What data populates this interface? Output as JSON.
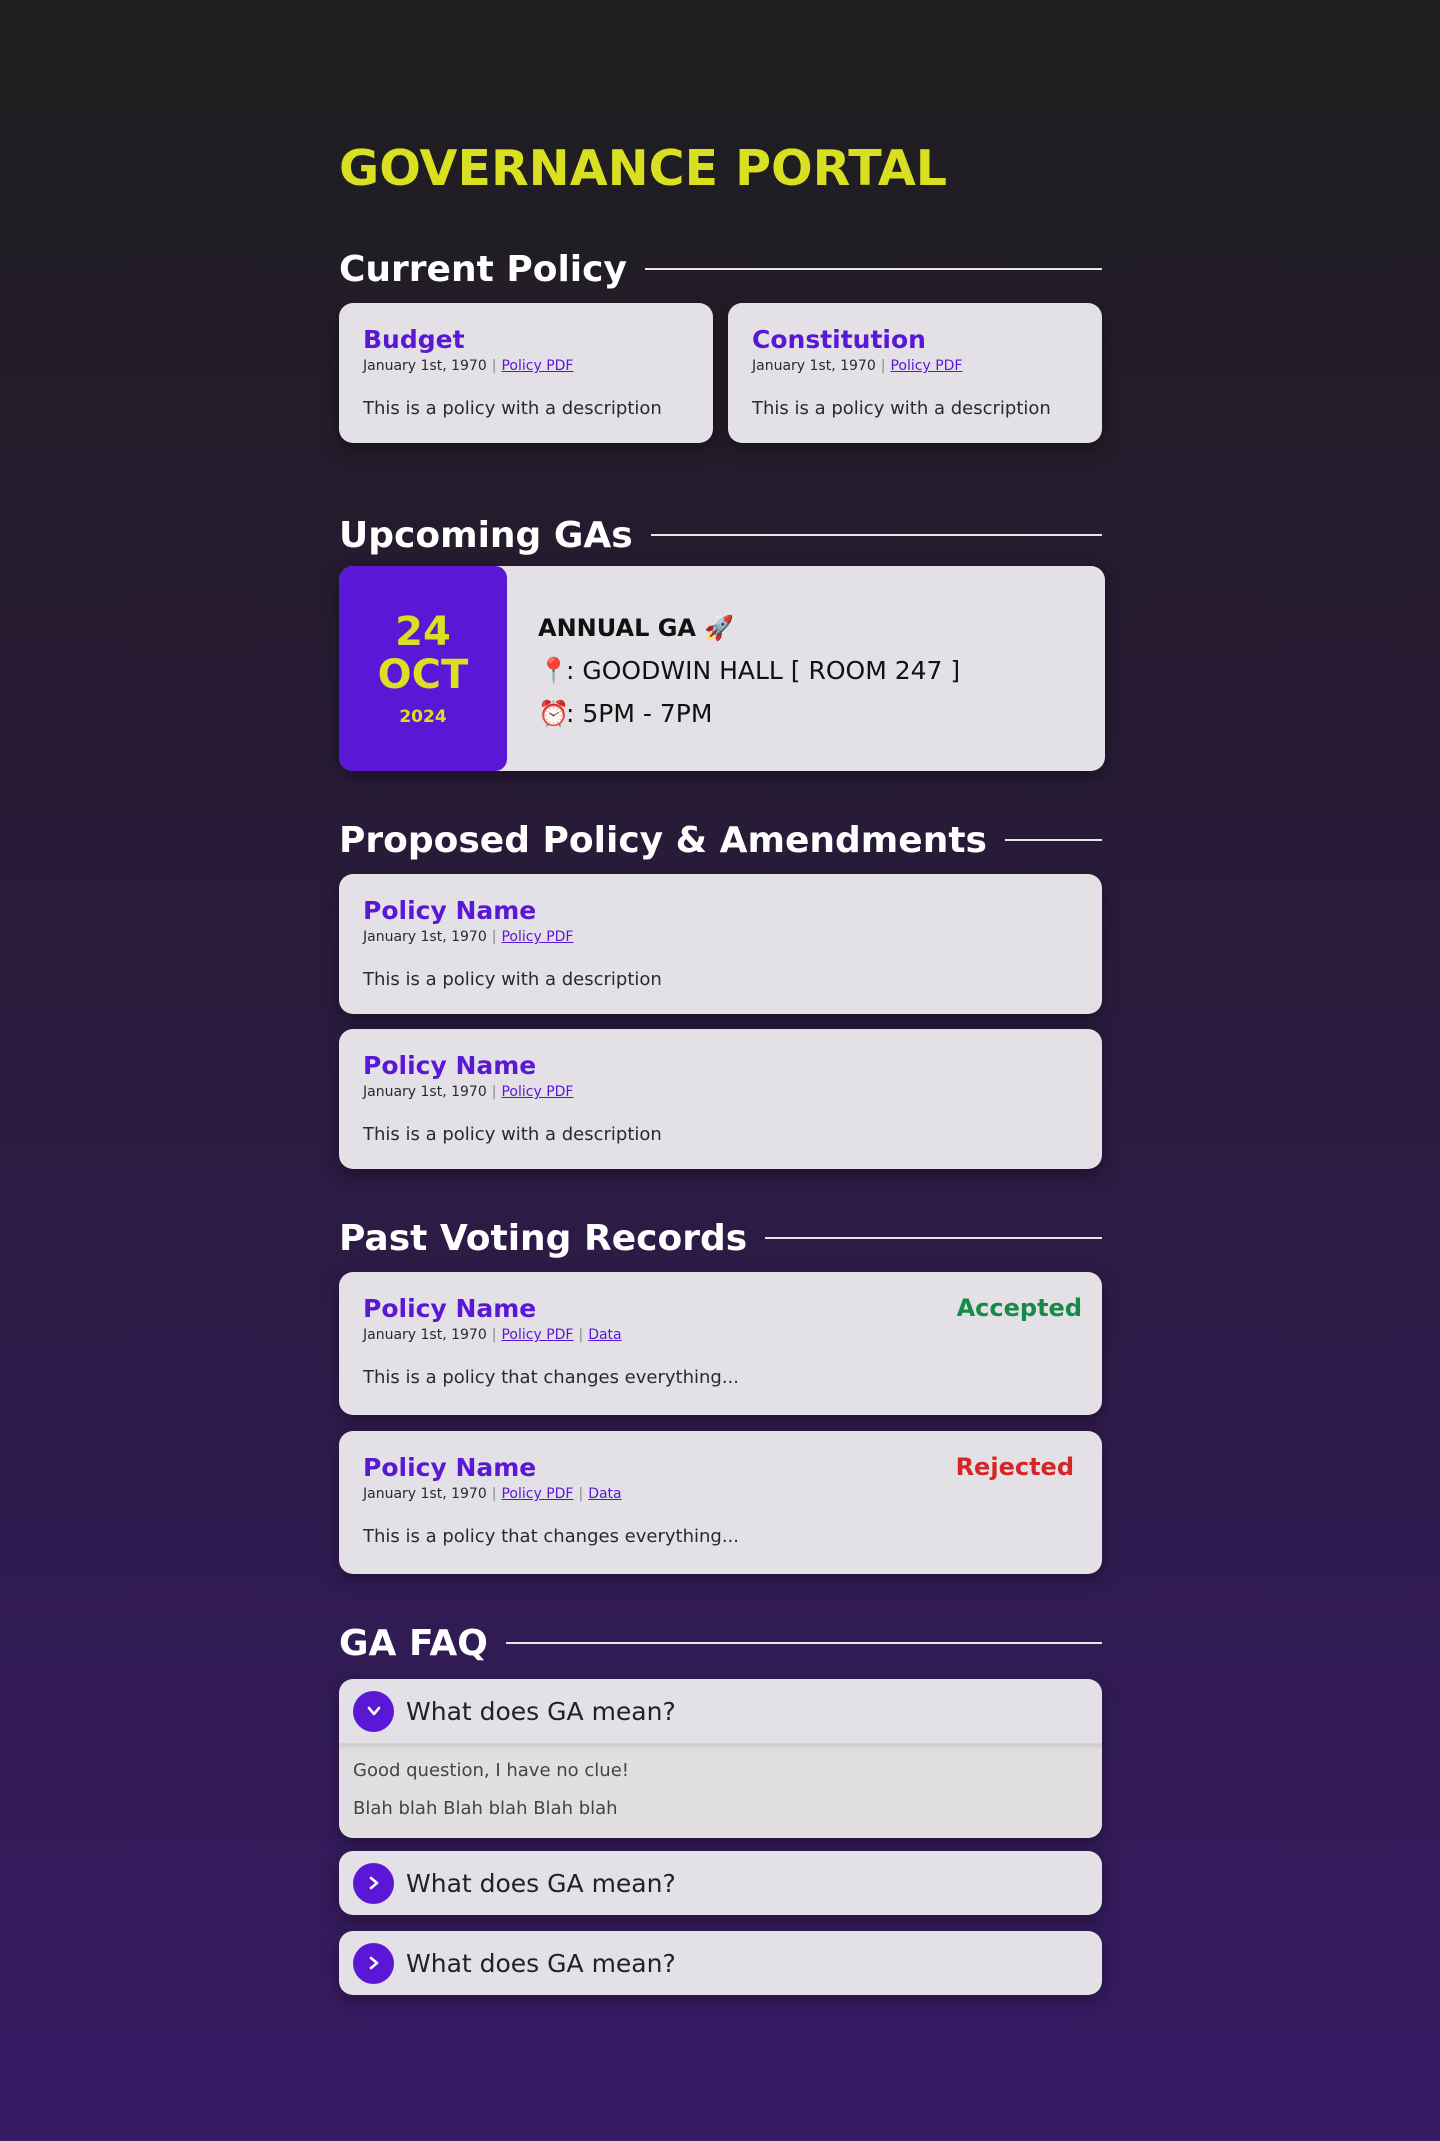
{
  "portal": {
    "title": "GOVERNANCE PORTAL"
  },
  "sections": {
    "current": "Current Policy",
    "upcoming": "Upcoming GAs",
    "proposed": "Proposed Policy & Amendments",
    "past": "Past Voting Records",
    "faq": "GA FAQ"
  },
  "current_policies": [
    {
      "title": "Budget",
      "date": "January 1st, 1970",
      "pdf_label": "Policy PDF",
      "description": "This is a policy with a description"
    },
    {
      "title": "Constitution",
      "date": "January 1st, 1970",
      "pdf_label": "Policy PDF",
      "description": "This is a policy with a description"
    }
  ],
  "ga": {
    "day": "24",
    "month": "OCT",
    "year": "2024",
    "name": "ANNUAL GA 🚀",
    "location_icon": "📍",
    "location": ": GOODWIN HALL [ ROOM 247 ]",
    "time_icon": "⏰",
    "time": ": 5PM - 7PM"
  },
  "proposed": [
    {
      "title": "Policy Name",
      "date": "January 1st, 1970",
      "pdf_label": "Policy PDF",
      "description": "This is a policy with a description"
    },
    {
      "title": "Policy Name",
      "date": "January 1st, 1970",
      "pdf_label": "Policy PDF",
      "description": "This is a policy with a description"
    }
  ],
  "past": [
    {
      "title": "Policy Name",
      "date": "January 1st, 1970",
      "pdf_label": "Policy PDF",
      "data_label": "Data",
      "description": "This is a policy that changes everything...",
      "status": "Accepted",
      "status_color": "#168a47"
    },
    {
      "title": "Policy Name",
      "date": "January 1st, 1970",
      "pdf_label": "Policy PDF",
      "data_label": "Data",
      "description": "This is a policy that changes everything...",
      "status": "Rejected",
      "status_color": "#d62525"
    }
  ],
  "faq": [
    {
      "question": "What does GA mean?",
      "expanded": true,
      "answers": [
        "Good question, I have no clue!",
        "Blah blah Blah blah Blah blah"
      ]
    },
    {
      "question": "What does GA mean?",
      "expanded": false
    },
    {
      "question": "What does GA mean?",
      "expanded": false
    }
  ],
  "colors": {
    "accent": "#5b17d6",
    "title": "#d9e021",
    "card": "#e3e1e6"
  }
}
